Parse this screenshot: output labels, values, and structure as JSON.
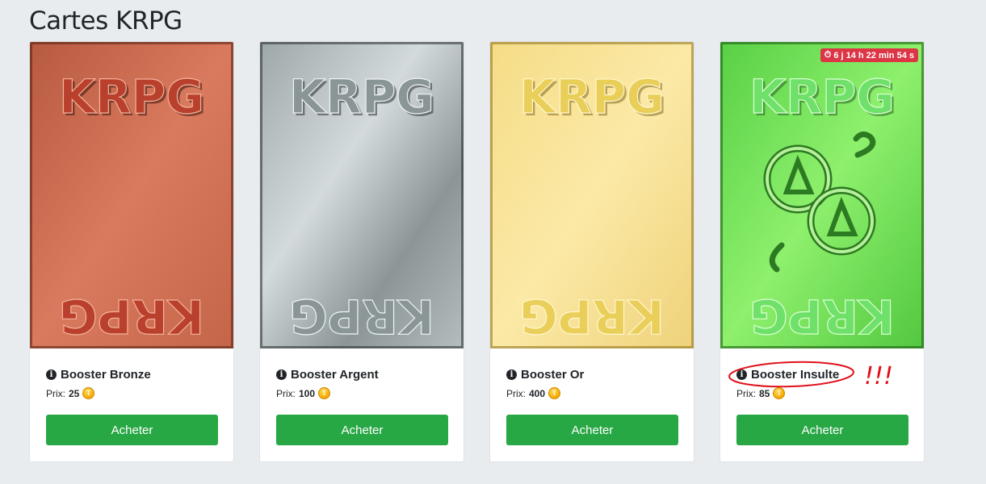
{
  "page": {
    "title": "Cartes KRPG"
  },
  "cards": [
    {
      "name": "Booster Bronze",
      "price_label": "Prix:",
      "price": "25",
      "button": "Acheter",
      "art_text": "KRPG",
      "colors": {
        "base": "#c9654a",
        "light": "#e78a70",
        "dark": "#8f3b26",
        "text": "#b9402c"
      }
    },
    {
      "name": "Booster Argent",
      "price_label": "Prix:",
      "price": "100",
      "button": "Acheter",
      "art_text": "KRPG",
      "colors": {
        "base": "#a9b1b2",
        "light": "#dfe5e6",
        "dark": "#5b6566",
        "text": "#8a9596"
      }
    },
    {
      "name": "Booster Or",
      "price_label": "Prix:",
      "price": "400",
      "button": "Acheter",
      "art_text": "KRPG",
      "colors": {
        "base": "#f1d880",
        "light": "#fbecaa",
        "dark": "#b79a3c",
        "text": "#e9cf5a"
      }
    },
    {
      "name": "Booster Insulte",
      "price_label": "Prix:",
      "price": "85",
      "button": "Acheter",
      "art_text": "KRPG",
      "timer": "6 j 14 h 22 min 54 s",
      "colors": {
        "base": "#5fd94c",
        "light": "#9cf283",
        "dark": "#2f8a25",
        "text": "#6fe06a"
      }
    }
  ],
  "annotation": {
    "marks": "!!!",
    "color": "#e0101a"
  },
  "colors": {
    "accent": "#28a745",
    "badge": "#dc3545",
    "background": "#e9ecef"
  }
}
